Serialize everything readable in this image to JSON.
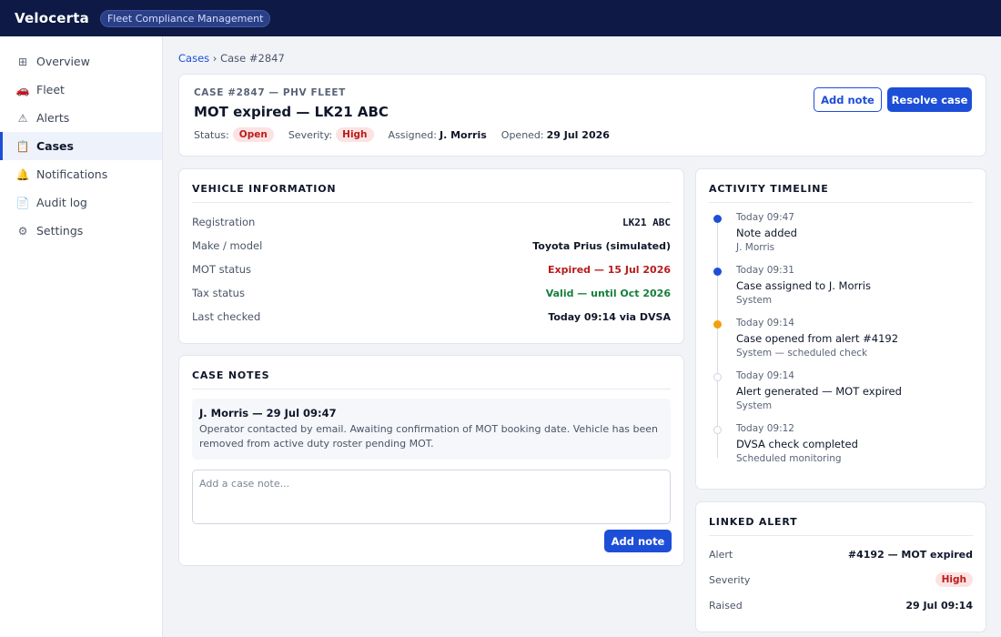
{
  "app": {
    "name": "Velocerta",
    "product_badge": "Fleet Compliance Management"
  },
  "sidebar": {
    "items": [
      {
        "label": "Overview",
        "icon": "grid-icon",
        "glyph": "⊞"
      },
      {
        "label": "Fleet",
        "icon": "car-icon",
        "glyph": "🚗"
      },
      {
        "label": "Alerts",
        "icon": "warning-icon",
        "glyph": "⚠"
      },
      {
        "label": "Cases",
        "icon": "clipboard-icon",
        "glyph": "📋",
        "active": true
      },
      {
        "label": "Notifications",
        "icon": "bell-icon",
        "glyph": "🔔"
      },
      {
        "label": "Audit log",
        "icon": "document-icon",
        "glyph": "📄"
      },
      {
        "label": "Settings",
        "icon": "gear-icon",
        "glyph": "⚙"
      }
    ]
  },
  "breadcrumb": {
    "parent": "Cases",
    "separator": "›",
    "current": "Case #2847"
  },
  "case": {
    "kicker": "CASE #2847 — PHV FLEET",
    "title": "MOT expired — LK21 ABC",
    "status_label": "Status:",
    "status": "Open",
    "severity_label": "Severity:",
    "severity": "High",
    "assigned_label": "Assigned:",
    "assigned": "J. Morris",
    "opened_label": "Opened:",
    "opened": "29 Jul 2026",
    "add_note_button": "Add note",
    "resolve_button": "Resolve case"
  },
  "vehicle": {
    "title": "VEHICLE INFORMATION",
    "rows": [
      {
        "label": "Registration",
        "value": "LK21 ABC",
        "style": "mono"
      },
      {
        "label": "Make / model",
        "value": "Toyota Prius (simulated)",
        "style": ""
      },
      {
        "label": "MOT status",
        "value": "Expired — 15 Jul 2026",
        "style": "red"
      },
      {
        "label": "Tax status",
        "value": "Valid — until Oct 2026",
        "style": "green"
      },
      {
        "label": "Last checked",
        "value": "Today 09:14 via DVSA",
        "style": ""
      }
    ]
  },
  "notes": {
    "title": "CASE NOTES",
    "items": [
      {
        "header": "J. Morris — 29 Jul 09:47",
        "body": "Operator contacted by email. Awaiting confirmation of MOT booking date. Vehicle has been removed from active duty roster pending MOT."
      }
    ],
    "input_placeholder": "Add a case note...",
    "add_button": "Add note"
  },
  "timeline": {
    "title": "ACTIVITY TIMELINE",
    "events": [
      {
        "time": "Today 09:47",
        "title": "Note added",
        "sub": "J. Morris",
        "dot": "filled-blue"
      },
      {
        "time": "Today 09:31",
        "title": "Case assigned to J. Morris",
        "sub": "System",
        "dot": "filled-blue"
      },
      {
        "time": "Today 09:14",
        "title": "Case opened from alert #4192",
        "sub": "System — scheduled check",
        "dot": "filled-amber"
      },
      {
        "time": "Today 09:14",
        "title": "Alert generated — MOT expired",
        "sub": "System",
        "dot": "hollow"
      },
      {
        "time": "Today 09:12",
        "title": "DVSA check completed",
        "sub": "Scheduled monitoring",
        "dot": "hollow"
      }
    ]
  },
  "linked_alert": {
    "title": "LINKED ALERT",
    "alert_label": "Alert",
    "alert_value": "#4192 — MOT expired",
    "severity_label": "Severity",
    "severity_value": "High",
    "raised_label": "Raised",
    "raised_value": "29 Jul 09:14"
  },
  "colors": {
    "topbar": "#0e1a45",
    "accent": "#1d4ed8",
    "danger": "#b91c1c",
    "success": "#15803d",
    "warning": "#f59e0b"
  }
}
